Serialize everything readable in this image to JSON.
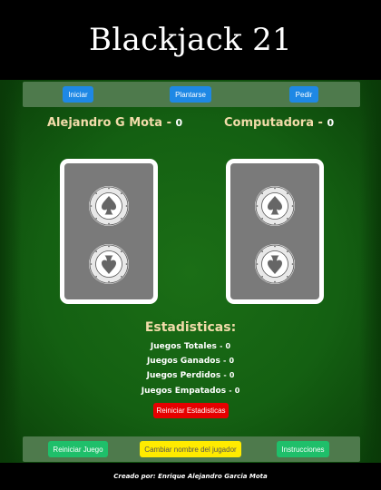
{
  "app": {
    "title": "Blackjack 21"
  },
  "controls": {
    "hit_label": "Iniciar",
    "stand_label": "Plantarse",
    "draw_label": "Pedir"
  },
  "players": [
    {
      "name": "Alejandro G Mota",
      "separator": "-",
      "score": "0"
    },
    {
      "name": "Computadora",
      "separator": "-",
      "score": "0"
    }
  ],
  "stats": {
    "title": "Estadisticas:",
    "rows": [
      {
        "label": "Juegos Totales",
        "separator": "-",
        "value": "0"
      },
      {
        "label": "Juegos Ganados",
        "separator": "-",
        "value": "0"
      },
      {
        "label": "Juegos Perdidos",
        "separator": "-",
        "value": "0"
      },
      {
        "label": "Juegos Empatados",
        "separator": "-",
        "value": "0"
      }
    ],
    "reset_label": "Reiniciar Estadisticas"
  },
  "bottom": {
    "restart_label": "Reiniciar Juego",
    "rename_label": "Cambiar nombre del jugador",
    "instructions_label": "Instrucciones"
  },
  "footer": {
    "credit": "Creado por: Enrique Alejandro Garcia Mota"
  },
  "colors": {
    "table": "#146012",
    "panel": "#4e7a4c",
    "blue": "#1e88e5",
    "green": "#1fbf6a",
    "yellow": "#ffeb00",
    "red": "#e60000",
    "gold": "#f2dcaa"
  },
  "card_emblem": {
    "ring_text": "AMERICAN CONTRACT BRIDGE LEAGUE",
    "icon": "spade-icon"
  }
}
